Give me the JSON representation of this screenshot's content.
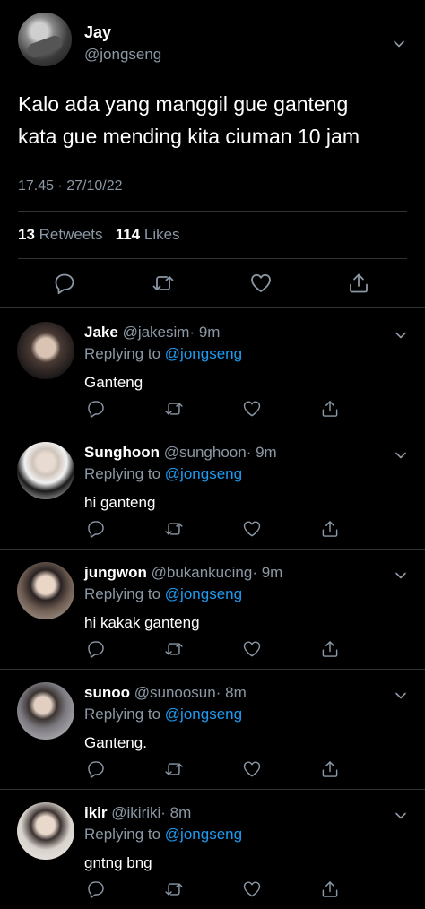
{
  "tweet": {
    "author_name": "Jay",
    "author_handle": "@jongseng",
    "text_line1": "Kalo ada yang manggil gue ganteng",
    "text_line2": "kata gue mending kita ciuman 10 jam",
    "timestamp": "17.45 · 27/10/22",
    "retweets_count": "13",
    "retweets_label": "Retweets",
    "likes_count": "114",
    "likes_label": "Likes"
  },
  "replies": [
    {
      "name": "Jake",
      "handle": "@jakesim",
      "time": "· 9m",
      "replying_prefix": "Replying to",
      "replying_to": "@jongseng",
      "text": "Ganteng"
    },
    {
      "name": "Sunghoon",
      "handle": "@sunghoon",
      "time": "· 9m",
      "replying_prefix": "Replying to",
      "replying_to": "@jongseng",
      "text": "hi ganteng"
    },
    {
      "name": "jungwon",
      "handle": "@bukankucing",
      "time": "· 9m",
      "replying_prefix": "Replying to",
      "replying_to": "@jongseng",
      "text": "hi kakak ganteng"
    },
    {
      "name": "sunoo",
      "handle": "@sunoosun",
      "time": "· 8m",
      "replying_prefix": "Replying to",
      "replying_to": "@jongseng",
      "text": "Ganteng."
    },
    {
      "name": "ikir",
      "handle": "@ikiriki",
      "time": "· 8m",
      "replying_prefix": "Replying to",
      "replying_to": "@jongseng",
      "text": "gntng bng"
    }
  ],
  "icons": [
    "chevron-down-icon",
    "reply-icon",
    "retweet-icon",
    "like-icon",
    "share-icon"
  ],
  "colors": {
    "background": "#000000",
    "text": "#e7e9ea",
    "secondary": "#8b98a5",
    "link": "#1d9bf0",
    "divider": "#2f3336"
  }
}
